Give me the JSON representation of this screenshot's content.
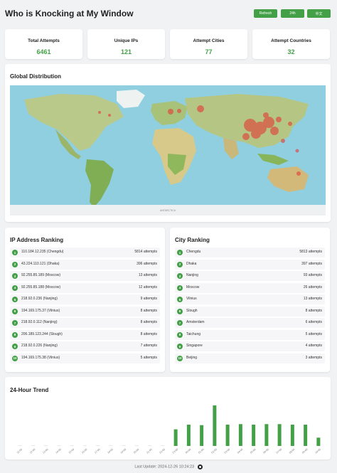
{
  "header": {
    "title": "Who is Knocking at My Window",
    "buttons": [
      "Refresh",
      "24h",
      "中文"
    ]
  },
  "stats": [
    {
      "label": "Total Attempts",
      "value": "6461"
    },
    {
      "label": "Unique IPs",
      "value": "121"
    },
    {
      "label": "Attempt Cities",
      "value": "77"
    },
    {
      "label": "Attempt Countries",
      "value": "32"
    }
  ],
  "map": {
    "title": "Global Distribution",
    "caption": "ANTARCTICA"
  },
  "ip_ranking": {
    "title": "IP Address Ranking",
    "items": [
      {
        "rank": "1",
        "label": "110.184.12.235 (Chengdu)",
        "count": "5814 attempts"
      },
      {
        "rank": "2",
        "label": "43.224.110.121 (Dhaka)",
        "count": "396 attempts"
      },
      {
        "rank": "3",
        "label": "92.255.85.189 (Moscow)",
        "count": "13 attempts"
      },
      {
        "rank": "4",
        "label": "92.255.85.188 (Moscow)",
        "count": "12 attempts"
      },
      {
        "rank": "5",
        "label": "218.92.0.236 (Nanjing)",
        "count": "9 attempts"
      },
      {
        "rank": "6",
        "label": "194.169.175.37 (Vilnius)",
        "count": "8 attempts"
      },
      {
        "rank": "7",
        "label": "218.92.0.112 (Nanjing)",
        "count": "8 attempts"
      },
      {
        "rank": "8",
        "label": "206.189.123.244 (Slough)",
        "count": "8 attempts"
      },
      {
        "rank": "9",
        "label": "218.92.0.226 (Nanjing)",
        "count": "7 attempts"
      },
      {
        "rank": "10",
        "label": "194.169.175.38 (Vilnius)",
        "count": "5 attempts"
      }
    ]
  },
  "city_ranking": {
    "title": "City Ranking",
    "items": [
      {
        "rank": "1",
        "label": "Chengdu",
        "count": "5813 attempts"
      },
      {
        "rank": "2",
        "label": "Dhaka",
        "count": "397 attempts"
      },
      {
        "rank": "3",
        "label": "Nanjing",
        "count": "93 attempts"
      },
      {
        "rank": "4",
        "label": "Moscow",
        "count": "26 attempts"
      },
      {
        "rank": "5",
        "label": "Vilnius",
        "count": "13 attempts"
      },
      {
        "rank": "6",
        "label": "Slough",
        "count": "8 attempts"
      },
      {
        "rank": "7",
        "label": "Amsterdam",
        "count": "6 attempts"
      },
      {
        "rank": "8",
        "label": "Taichung",
        "count": "5 attempts"
      },
      {
        "rank": "9",
        "label": "Singapore",
        "count": "4 attempts"
      },
      {
        "rank": "10",
        "label": "Beijing",
        "count": "3 attempts"
      }
    ]
  },
  "trend": {
    "title": "24-Hour Trend"
  },
  "chart_data": {
    "type": "bar",
    "title": "24-Hour Trend",
    "categories": [
      "11:00",
      "12:00",
      "13:00",
      "14:00",
      "15:00",
      "16:00",
      "17:00",
      "18:00",
      "19:00",
      "20:00",
      "21:00",
      "22:00",
      "23:00",
      "00:00",
      "01:00",
      "02:00",
      "03:00",
      "04:00",
      "05:00",
      "06:00",
      "07:00",
      "08:00",
      "09:00",
      "10:00"
    ],
    "values": [
      0,
      0,
      0,
      0,
      0,
      0,
      0,
      0,
      0,
      0,
      0,
      0,
      320,
      410,
      400,
      780,
      410,
      420,
      410,
      420,
      420,
      410,
      410,
      160
    ],
    "ylim": [
      0,
      820
    ],
    "bar_color": "#43a047",
    "grid": false
  },
  "footer": {
    "text": "Last Update: 2024-12-26 10:24:23"
  },
  "colors": {
    "accent": "#43a047",
    "hotspot": "#e53935"
  }
}
